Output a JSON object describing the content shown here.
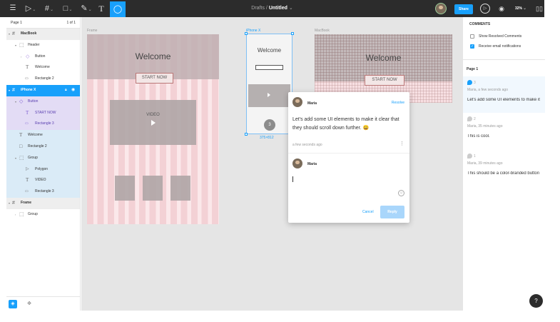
{
  "toolbar": {
    "breadcrumb": "Drafts",
    "separator": "/",
    "title": "Untitled",
    "title_caret": "⌄",
    "share_label": "Share",
    "zoom": "32%",
    "menu_icon": "hamburger-icon",
    "move_icon": "move-tool-icon",
    "frame_icon": "frame-tool-icon",
    "shape_icon": "rectangle-tool-icon",
    "pen_icon": "pen-tool-icon",
    "text_icon": "text-tool-icon",
    "comment_icon": "comment-tool-icon",
    "accent": "#18a0fb"
  },
  "layers": {
    "page": "Page 1",
    "page_count": "1 of 1",
    "items": [
      {
        "label": "MacBook"
      },
      {
        "label": "Header"
      },
      {
        "label": "Button"
      },
      {
        "label": "Welcome"
      },
      {
        "label": "Rectangle 2"
      },
      {
        "label": "iPhone X"
      },
      {
        "label": "Button"
      },
      {
        "label": "START NOW"
      },
      {
        "label": "Rectangle 3"
      },
      {
        "label": "Welcome"
      },
      {
        "label": "Rectangle 2"
      },
      {
        "label": "Group"
      },
      {
        "label": "Polygon"
      },
      {
        "label": "VIDEO"
      },
      {
        "label": "Rectangle 3"
      },
      {
        "label": "Frame"
      },
      {
        "label": "Group"
      }
    ]
  },
  "canvas": {
    "frame_label": "Frame",
    "iphone_label": "iPhone X",
    "macbook_label": "MacBook",
    "iphone_size": "375×812",
    "welcome": "Welcome",
    "start_now": "START NOW",
    "video": "VIDEO",
    "pin_number": "3"
  },
  "popup": {
    "author": "Maria",
    "resolve_label": "Resolve",
    "message": "Let's add some UI elements to make it clear that they should scroll down further. 😀",
    "time": "a few seconds ago",
    "reply_author": "Maria",
    "cancel_label": "Cancel",
    "reply_label": "Reply"
  },
  "comments": {
    "title": "COMMENTS",
    "show_resolved": "Show Resolved Comments",
    "receive_email": "Receive email notifications",
    "page": "Page 1",
    "threads": [
      {
        "num": "3",
        "meta": "Maria, a few seconds ago",
        "text": "Let's add some UI elements to make it"
      },
      {
        "num": "2",
        "meta": "Maria, 35 minutes ago",
        "text": "This is cool."
      },
      {
        "num": "1",
        "meta": "Maria, 39 minutes ago",
        "text": "This should be a color-branded button"
      }
    ]
  }
}
